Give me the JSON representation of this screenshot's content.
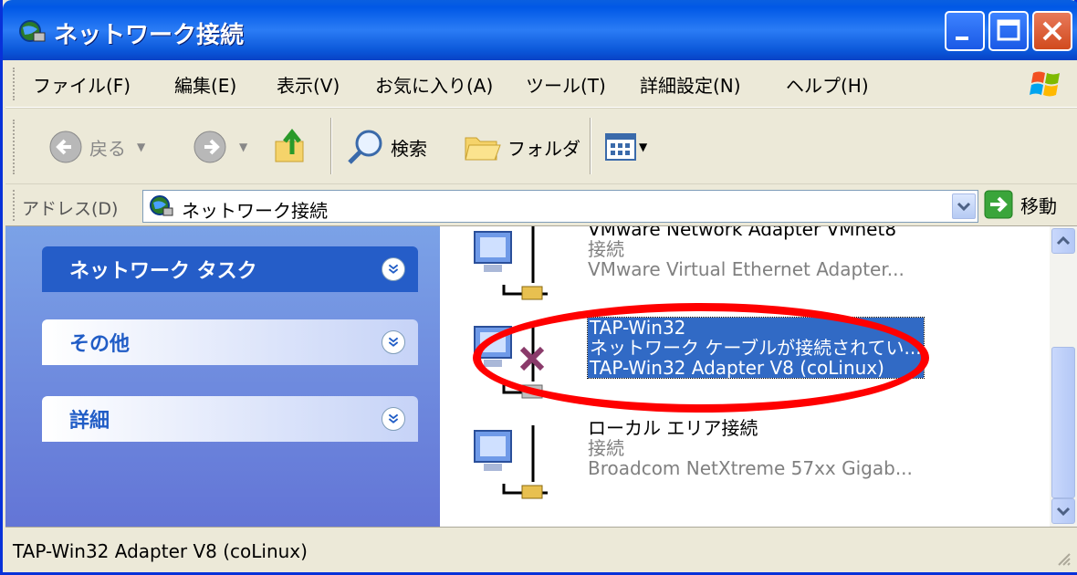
{
  "window": {
    "title": "ネットワーク接続"
  },
  "menu": {
    "items": [
      "ファイル(F)",
      "編集(E)",
      "表示(V)",
      "お気に入り(A)",
      "ツール(T)",
      "詳細設定(N)",
      "ヘルプ(H)"
    ]
  },
  "toolbar": {
    "back_label": "戻る",
    "search_label": "検索",
    "folder_label": "フォルダ"
  },
  "address": {
    "label": "アドレス(D)",
    "value": "ネットワーク接続",
    "go_label": "移動"
  },
  "tasks": {
    "network_tasks": "ネットワーク タスク",
    "other": "その他",
    "details": "詳細"
  },
  "connections": [
    {
      "name": "VMware Network Adapter VMnet8",
      "status": "接続",
      "device": "VMware Virtual Ethernet Adapter..."
    },
    {
      "name": "TAP-Win32",
      "status": "ネットワーク ケーブルが接続されてい...",
      "device": "TAP-Win32 Adapter V8 (coLinux)"
    },
    {
      "name": "ローカル エリア接続",
      "status": "接続",
      "device": "Broadcom NetXtreme 57xx Gigab..."
    }
  ],
  "statusbar": {
    "text": "TAP-Win32 Adapter V8 (coLinux)"
  },
  "colors": {
    "titlebar": "#0058e6",
    "selection": "#316ac5",
    "highlight_ring": "#ff0000",
    "task_pane": "#6375d6"
  }
}
